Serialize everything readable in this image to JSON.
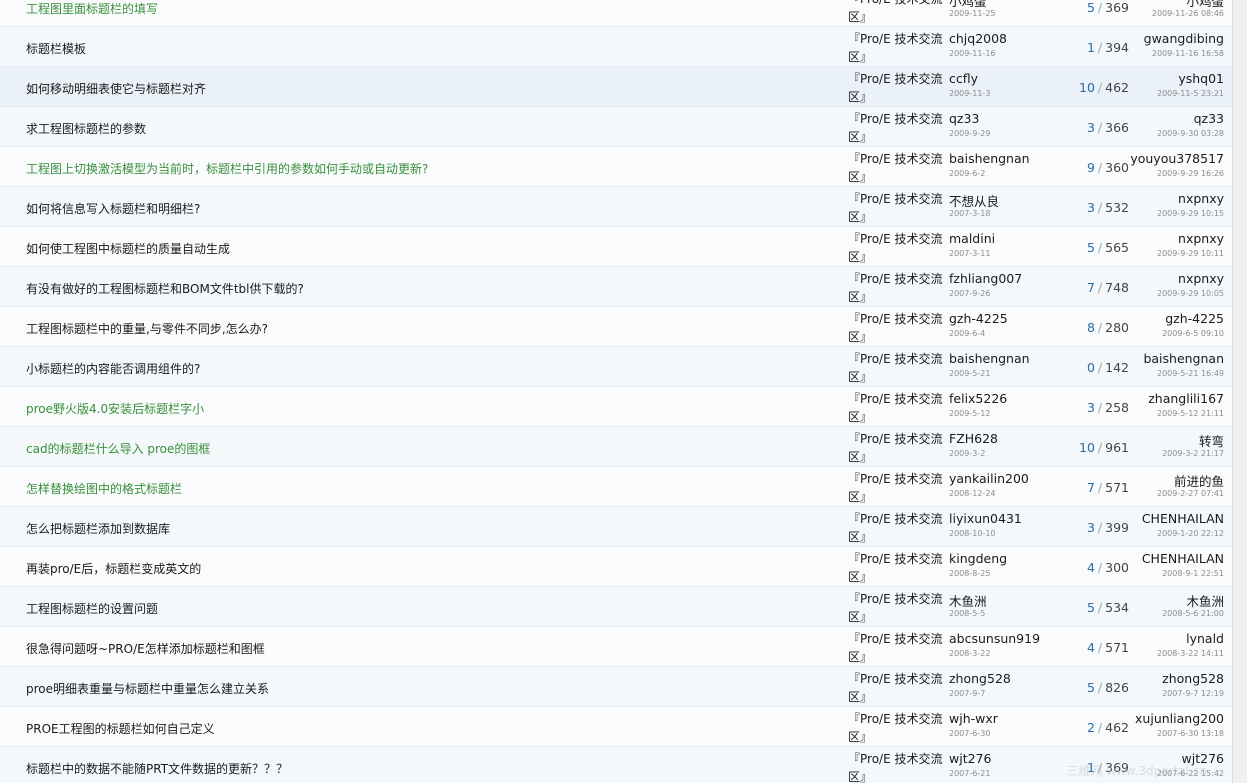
{
  "threads": [
    {
      "title": "工程图里面标题栏的填写",
      "green": true,
      "forum": "『Pro/E 技术交流区』",
      "author": "小鸡蛋",
      "author_date": "2009-11-25",
      "replies": "5",
      "views": "369",
      "last_poster": "小鸡蛋",
      "last_date": "2009-11-26 08:46"
    },
    {
      "title": "标题栏模板",
      "green": false,
      "forum": "『Pro/E 技术交流区』",
      "author": "chjq2008",
      "author_date": "2009-11-16",
      "replies": "1",
      "views": "394",
      "last_poster": "gwangdibing",
      "last_date": "2009-11-16 16:58"
    },
    {
      "title": "如何移动明细表使它与标题栏对齐",
      "green": false,
      "forum": "『Pro/E 技术交流区』",
      "author": "ccfly",
      "author_date": "2009-11-3",
      "replies": "10",
      "views": "462",
      "last_poster": "yshq01",
      "last_date": "2009-11-5 23:21"
    },
    {
      "title": "求工程图标题栏的参数",
      "green": false,
      "forum": "『Pro/E 技术交流区』",
      "author": "qz33",
      "author_date": "2009-9-29",
      "replies": "3",
      "views": "366",
      "last_poster": "qz33",
      "last_date": "2009-9-30 03:28"
    },
    {
      "title": "工程图上切换激活模型为当前时，标题栏中引用的参数如何手动或自动更新?",
      "green": true,
      "forum": "『Pro/E 技术交流区』",
      "author": "baishengnan",
      "author_date": "2009-6-2",
      "replies": "9",
      "views": "360",
      "last_poster": "youyou378517",
      "last_date": "2009-9-29 16:26"
    },
    {
      "title": "如何将信息写入标题栏和明细栏?",
      "green": false,
      "forum": "『Pro/E 技术交流区』",
      "author": "不想从良",
      "author_date": "2007-3-18",
      "replies": "3",
      "views": "532",
      "last_poster": "nxpnxy",
      "last_date": "2009-9-29 10:15"
    },
    {
      "title": "如何使工程图中标题栏的质量自动生成",
      "green": false,
      "forum": "『Pro/E 技术交流区』",
      "author": "maldini",
      "author_date": "2007-3-11",
      "replies": "5",
      "views": "565",
      "last_poster": "nxpnxy",
      "last_date": "2009-9-29 10:11"
    },
    {
      "title": "有没有做好的工程图标题栏和BOM文件tbl供下载的?",
      "green": false,
      "forum": "『Pro/E 技术交流区』",
      "author": "fzhliang007",
      "author_date": "2007-9-26",
      "replies": "7",
      "views": "748",
      "last_poster": "nxpnxy",
      "last_date": "2009-9-29 10:05"
    },
    {
      "title": "工程图标题栏中的重量,与零件不同步,怎么办?",
      "green": false,
      "forum": "『Pro/E 技术交流区』",
      "author": "gzh-4225",
      "author_date": "2009-6-4",
      "replies": "8",
      "views": "280",
      "last_poster": "gzh-4225",
      "last_date": "2009-6-5 09:10"
    },
    {
      "title": "小标题栏的内容能否调用组件的?",
      "green": false,
      "forum": "『Pro/E 技术交流区』",
      "author": "baishengnan",
      "author_date": "2009-5-21",
      "replies": "0",
      "views": "142",
      "last_poster": "baishengnan",
      "last_date": "2009-5-21 16:49"
    },
    {
      "title": "proe野火版4.0安装后标题栏字小",
      "green": true,
      "forum": "『Pro/E 技术交流区』",
      "author": "felix5226",
      "author_date": "2009-5-12",
      "replies": "3",
      "views": "258",
      "last_poster": "zhanglili167",
      "last_date": "2009-5-12 21:11"
    },
    {
      "title": "cad的标题栏什么导入 proe的图框",
      "green": true,
      "forum": "『Pro/E 技术交流区』",
      "author": "FZH628",
      "author_date": "2009-3-2",
      "replies": "10",
      "views": "961",
      "last_poster": "转弯",
      "last_date": "2009-3-2 21:17"
    },
    {
      "title": "怎样替换绘图中的格式标题栏",
      "green": true,
      "forum": "『Pro/E 技术交流区』",
      "author": "yankailin200",
      "author_date": "2008-12-24",
      "replies": "7",
      "views": "571",
      "last_poster": "前进的鱼",
      "last_date": "2009-2-27 07:41"
    },
    {
      "title": "怎么把标题栏添加到数据库",
      "green": false,
      "forum": "『Pro/E 技术交流区』",
      "author": "liyixun0431",
      "author_date": "2008-10-10",
      "replies": "3",
      "views": "399",
      "last_poster": "CHENHAILAN",
      "last_date": "2009-1-20 22:12"
    },
    {
      "title": "再装pro/E后，标题栏变成英文的",
      "green": false,
      "forum": "『Pro/E 技术交流区』",
      "author": "kingdeng",
      "author_date": "2008-8-25",
      "replies": "4",
      "views": "300",
      "last_poster": "CHENHAILAN",
      "last_date": "2008-9-1 22:51"
    },
    {
      "title": "工程图标题栏的设置问题",
      "green": false,
      "forum": "『Pro/E 技术交流区』",
      "author": "木鱼洲",
      "author_date": "2008-5-5",
      "replies": "5",
      "views": "534",
      "last_poster": "木鱼洲",
      "last_date": "2008-5-6 21:00"
    },
    {
      "title": "很急得问题呀~PRO/E怎样添加标题栏和图框",
      "green": false,
      "forum": "『Pro/E 技术交流区』",
      "author": "abcsunsun919",
      "author_date": "2008-3-22",
      "replies": "4",
      "views": "571",
      "last_poster": "lynald",
      "last_date": "2008-3-22 14:11"
    },
    {
      "title": "proe明细表重量与标题栏中重量怎么建立关系",
      "green": false,
      "forum": "『Pro/E 技术交流区』",
      "author": "zhong528",
      "author_date": "2007-9-7",
      "replies": "5",
      "views": "826",
      "last_poster": "zhong528",
      "last_date": "2007-9-7 12:19"
    },
    {
      "title": "PROE工程图的标题栏如何自己定义",
      "green": false,
      "forum": "『Pro/E 技术交流区』",
      "author": "wjh-wxr",
      "author_date": "2007-6-30",
      "replies": "2",
      "views": "462",
      "last_poster": "xujunliang200",
      "last_date": "2007-6-30 13:18"
    },
    {
      "title": "标题栏中的数据不能随PRT文件数据的更新？？？",
      "green": false,
      "forum": "『Pro/E 技术交流区』",
      "author": "wjt276",
      "author_date": "2007-6-21",
      "replies": "1",
      "views": "369",
      "last_poster": "wjt276",
      "last_date": "2007-6-22 15:42"
    }
  ],
  "watermark": "三维网 www.3dportal.cn"
}
